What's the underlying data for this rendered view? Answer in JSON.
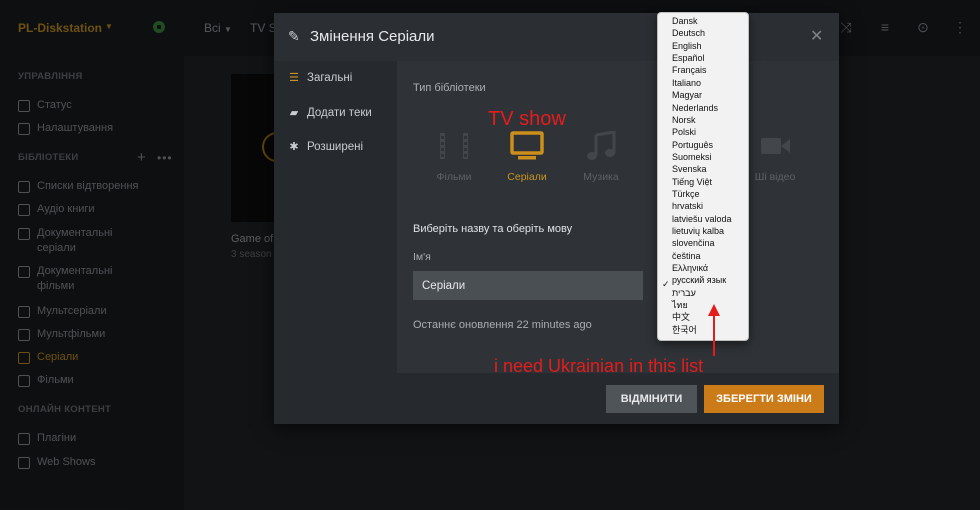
{
  "server": {
    "name": "PL-Diskstation"
  },
  "topbar": {
    "filter_all": "Всі",
    "filter_tv": "TV S"
  },
  "sidebar": {
    "manage_heading": "УПРАВЛІННЯ",
    "manage_items": [
      {
        "label": "Статус",
        "icon": "pulse-icon"
      },
      {
        "label": "Налаштування",
        "icon": "gear-icon"
      }
    ],
    "libraries_heading": "БІБЛІОТЕКИ",
    "library_items": [
      {
        "label": "Списки відтворення",
        "icon": "list-icon"
      },
      {
        "label": "Аудіо книги",
        "icon": "music-note-icon"
      },
      {
        "label": "Документальні серіали",
        "icon": "tv-icon"
      },
      {
        "label": "Документальні фільми",
        "icon": "film-icon"
      },
      {
        "label": "Мультсеріали",
        "icon": "tv-icon"
      },
      {
        "label": "Мультфільми",
        "icon": "film-icon"
      },
      {
        "label": "Серіали",
        "icon": "tv-icon"
      },
      {
        "label": "Фільми",
        "icon": "film-icon"
      }
    ],
    "online_heading": "ОНЛАЙН КОНТЕНТ",
    "online_items": [
      {
        "label": "Плагіни",
        "icon": "grid-icon"
      },
      {
        "label": "Web Shows",
        "icon": "play-icon"
      }
    ]
  },
  "content": {
    "poster_title": "Game of",
    "poster_sub": "3 season"
  },
  "modal": {
    "title": "Змінення Серіали",
    "nav": [
      {
        "label": "Загальні",
        "icon": "list-icon"
      },
      {
        "label": "Додати теки",
        "icon": "folder-icon"
      },
      {
        "label": "Розширені",
        "icon": "gear-icon"
      }
    ],
    "library_type_label": "Тип бібліотеки",
    "types": [
      {
        "label": "Фільми",
        "icon": "film-icon"
      },
      {
        "label": "Серіали",
        "icon": "tv-icon"
      },
      {
        "label": "Музика",
        "icon": "music-note-icon"
      },
      {
        "label": "Ші відео",
        "icon": "video-camera-icon"
      }
    ],
    "choose_label": "Виберіть назву та оберіть мову",
    "name_label": "Ім'я",
    "name_value": "Серіали",
    "last_update": "Останнє оновлення 22 minutes ago",
    "cancel_label": "ВІДМІНИТИ",
    "save_label": "ЗБЕРЕГТИ ЗМІНИ"
  },
  "language_dropdown": {
    "selected": "русский язык",
    "options": [
      "Dansk",
      "Deutsch",
      "English",
      "Español",
      "Français",
      "Italiano",
      "Magyar",
      "Nederlands",
      "Norsk",
      "Polski",
      "Português",
      "Suomeksi",
      "Svenska",
      "Tiếng Việt",
      "Türkçe",
      "hrvatski",
      "latviešu valoda",
      "lietuvių kalba",
      "slovenčina",
      "čeština",
      "Ελληνικά",
      "русский язык",
      "עברית",
      "ไทย",
      "中文",
      "한국어"
    ]
  },
  "annotations": {
    "tv_show": "TV show",
    "need_ukrainian": "i need Ukrainian in this list"
  },
  "colors": {
    "accent": "#cc7b19",
    "annotation": "#e51c1c"
  }
}
